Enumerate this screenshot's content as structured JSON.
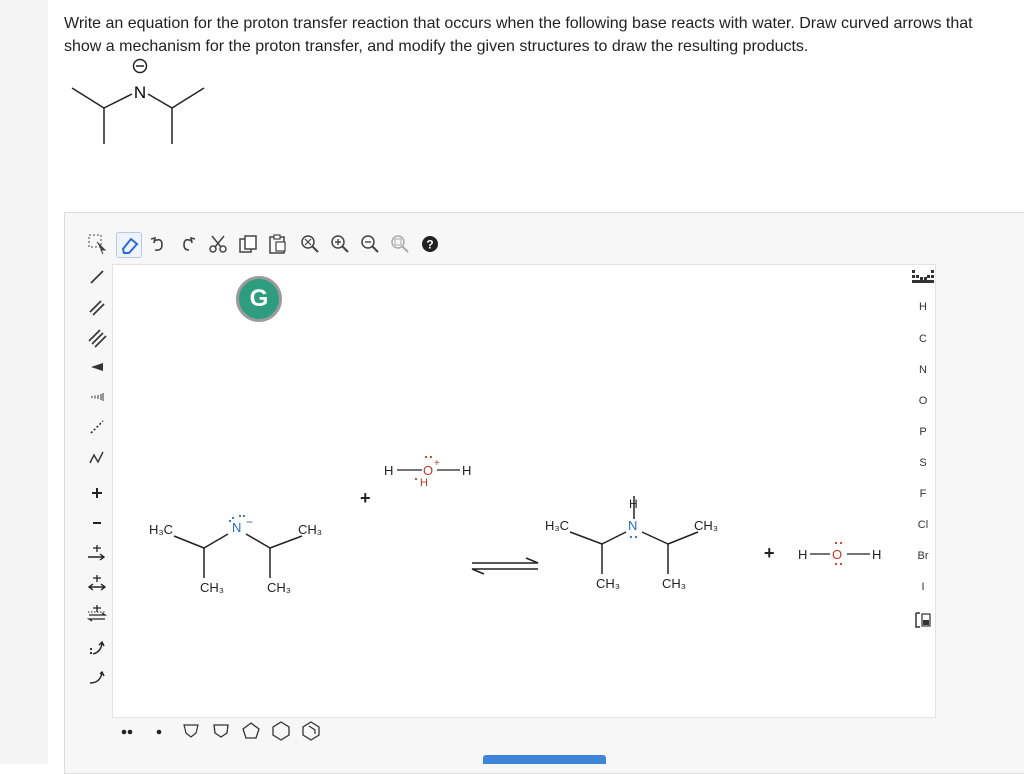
{
  "question": {
    "text": "Write an equation for the proton transfer reaction that occurs when the following base reacts with water. Draw curved arrows that show a mechanism for the proton transfer, and modify the given structures to draw the resulting products."
  },
  "given_structure": {
    "atom": "N",
    "charge": "−"
  },
  "toolbar": {
    "icons": [
      "select-icon",
      "erase-icon",
      "undo-icon",
      "redo-icon",
      "cut-icon",
      "copy-icon",
      "paste-icon",
      "zoom-fit-icon",
      "zoom-in-icon",
      "zoom-out-icon",
      "zoom-reset-icon",
      "help-icon"
    ],
    "help_glyph": "?"
  },
  "left_tools": [
    "single-bond-tool",
    "double-bond-tool",
    "triple-bond-tool",
    "wedge-bond-tool",
    "hash-bond-tool",
    "dashed-bond-tool",
    "chain-tool",
    "positive-charge-tool",
    "negative-charge-tool",
    "forward-arrow-tool",
    "reversible-arrow-tool",
    "resonance-arrow-tool",
    "equilibrium-arrow-tool",
    "electron-pair-arrow-tool",
    "single-electron-arrow-tool"
  ],
  "right_tools": {
    "periodic_table": "periodic-table-icon",
    "elements": [
      "H",
      "C",
      "N",
      "O",
      "P",
      "S",
      "F",
      "Cl",
      "Br",
      "I"
    ],
    "template": "template-icon"
  },
  "bottom_tools": [
    "lone-pair-tool",
    "radical-tool",
    "cyclopropane-tool",
    "cyclobutane-tool",
    "cyclopentane-tool",
    "cyclohexane-tool",
    "benzene-tool"
  ],
  "grammarly_badge": "G",
  "canvas": {
    "reactant_base": {
      "left_methyl": "H₃C",
      "right_methyl": "CH₃",
      "lower_left_methyl": "CH₃",
      "lower_right_methyl": "CH₃",
      "center_atom": "N",
      "charge": "−"
    },
    "plus_1": "+",
    "water": {
      "h_left": "H",
      "o": "O",
      "h_right": "H",
      "h_below": "H",
      "charge": "+"
    },
    "product_amine": {
      "left_methyl": "H₃C",
      "right_methyl": "CH₃",
      "lower_left_methyl": "CH₃",
      "lower_right_methyl": "CH₃",
      "center_atom": "N",
      "h_atom": "H"
    },
    "plus_2": "+",
    "hydroxide": {
      "h_left": "H",
      "o": "O",
      "h_right": "H"
    }
  }
}
